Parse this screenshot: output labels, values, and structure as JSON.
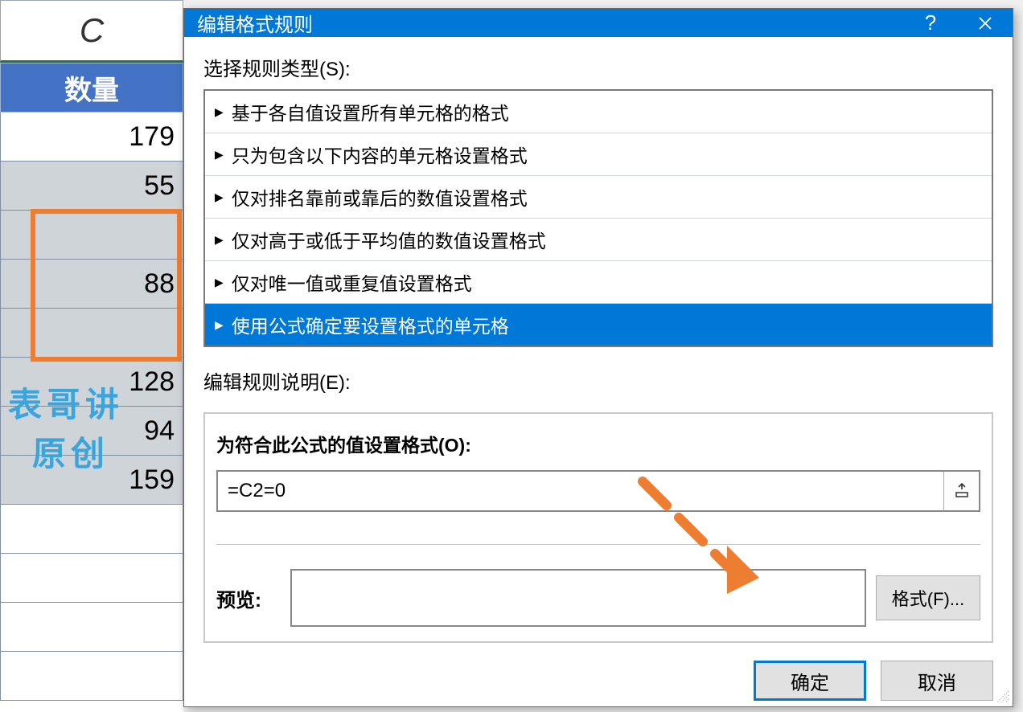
{
  "sheet": {
    "column_letter": "C",
    "column_title": "数量",
    "cells": [
      "179",
      "55",
      "",
      "88",
      "",
      "128",
      "94",
      "159",
      "",
      "",
      "",
      ""
    ]
  },
  "watermark": {
    "line1": "表哥讲",
    "line2": "原创"
  },
  "dialog": {
    "title": "编辑格式规则",
    "section_rule_type": "选择规则类型(S):",
    "rule_types": [
      "基于各自值设置所有单元格的格式",
      "只为包含以下内容的单元格设置格式",
      "仅对排名靠前或靠后的数值设置格式",
      "仅对高于或低于平均值的数值设置格式",
      "仅对唯一值或重复值设置格式",
      "使用公式确定要设置格式的单元格"
    ],
    "selected_rule_index": 5,
    "section_edit": "编辑规则说明(E):",
    "formula_label": "为符合此公式的值设置格式(O):",
    "formula_value": "=C2=0",
    "preview_label": "预览:",
    "format_button": "格式(F)...",
    "ok": "确定",
    "cancel": "取消"
  }
}
